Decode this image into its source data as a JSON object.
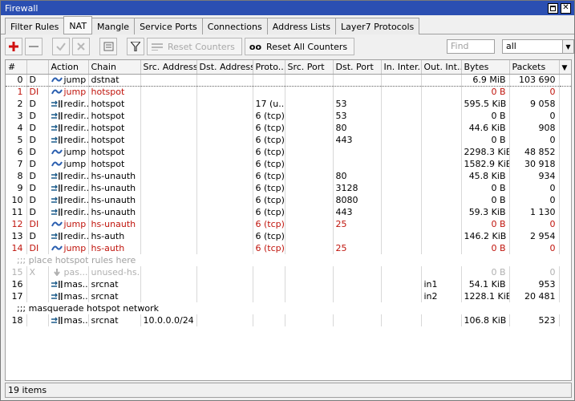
{
  "window": {
    "title": "Firewall"
  },
  "tabs": [
    {
      "label": "Filter Rules",
      "active": false
    },
    {
      "label": "NAT",
      "active": true
    },
    {
      "label": "Mangle",
      "active": false
    },
    {
      "label": "Service Ports",
      "active": false
    },
    {
      "label": "Connections",
      "active": false
    },
    {
      "label": "Address Lists",
      "active": false
    },
    {
      "label": "Layer7 Protocols",
      "active": false
    }
  ],
  "toolbar": {
    "reset_counters_label": "Reset Counters",
    "reset_all_counters_label": "Reset All Counters",
    "oo_label": "oo",
    "find_placeholder": "Find",
    "filter_value": "all"
  },
  "columns": [
    "#",
    "",
    "Action",
    "Chain",
    "Src. Address",
    "Dst. Address",
    "Proto...",
    "Src. Port",
    "Dst. Port",
    "In. Inter...",
    "Out. Int...",
    "Bytes",
    "Packets"
  ],
  "rows": [
    {
      "type": "rule",
      "num": "0",
      "flags": "D",
      "action": "jump",
      "icon": "jump",
      "chain": "dstnat",
      "src": "",
      "dst": "",
      "proto": "",
      "sport": "",
      "dport": "",
      "inif": "",
      "outif": "",
      "bytes": "6.9 MiB",
      "packets": "103 690",
      "state": "selected"
    },
    {
      "type": "rule",
      "num": "1",
      "flags": "DI",
      "action": "jump",
      "icon": "jump",
      "chain": "hotspot",
      "src": "",
      "dst": "",
      "proto": "",
      "sport": "",
      "dport": "",
      "inif": "",
      "outif": "",
      "bytes": "0 B",
      "packets": "0",
      "state": "disabled"
    },
    {
      "type": "rule",
      "num": "2",
      "flags": "D",
      "action": "redir...",
      "icon": "redir",
      "chain": "hotspot",
      "src": "",
      "dst": "",
      "proto": "17 (u...",
      "sport": "",
      "dport": "53",
      "inif": "",
      "outif": "",
      "bytes": "595.5 KiB",
      "packets": "9 058",
      "state": ""
    },
    {
      "type": "rule",
      "num": "3",
      "flags": "D",
      "action": "redir...",
      "icon": "redir",
      "chain": "hotspot",
      "src": "",
      "dst": "",
      "proto": "6 (tcp)",
      "sport": "",
      "dport": "53",
      "inif": "",
      "outif": "",
      "bytes": "0 B",
      "packets": "0",
      "state": ""
    },
    {
      "type": "rule",
      "num": "4",
      "flags": "D",
      "action": "redir...",
      "icon": "redir",
      "chain": "hotspot",
      "src": "",
      "dst": "",
      "proto": "6 (tcp)",
      "sport": "",
      "dport": "80",
      "inif": "",
      "outif": "",
      "bytes": "44.6 KiB",
      "packets": "908",
      "state": ""
    },
    {
      "type": "rule",
      "num": "5",
      "flags": "D",
      "action": "redir...",
      "icon": "redir",
      "chain": "hotspot",
      "src": "",
      "dst": "",
      "proto": "6 (tcp)",
      "sport": "",
      "dport": "443",
      "inif": "",
      "outif": "",
      "bytes": "0 B",
      "packets": "0",
      "state": ""
    },
    {
      "type": "rule",
      "num": "6",
      "flags": "D",
      "action": "jump",
      "icon": "jump",
      "chain": "hotspot",
      "src": "",
      "dst": "",
      "proto": "6 (tcp)",
      "sport": "",
      "dport": "",
      "inif": "",
      "outif": "",
      "bytes": "2298.3 KiB",
      "packets": "48 852",
      "state": ""
    },
    {
      "type": "rule",
      "num": "7",
      "flags": "D",
      "action": "jump",
      "icon": "jump",
      "chain": "hotspot",
      "src": "",
      "dst": "",
      "proto": "6 (tcp)",
      "sport": "",
      "dport": "",
      "inif": "",
      "outif": "",
      "bytes": "1582.9 KiB",
      "packets": "30 918",
      "state": ""
    },
    {
      "type": "rule",
      "num": "8",
      "flags": "D",
      "action": "redir...",
      "icon": "redir",
      "chain": "hs-unauth",
      "src": "",
      "dst": "",
      "proto": "6 (tcp)",
      "sport": "",
      "dport": "80",
      "inif": "",
      "outif": "",
      "bytes": "45.8 KiB",
      "packets": "934",
      "state": ""
    },
    {
      "type": "rule",
      "num": "9",
      "flags": "D",
      "action": "redir...",
      "icon": "redir",
      "chain": "hs-unauth",
      "src": "",
      "dst": "",
      "proto": "6 (tcp)",
      "sport": "",
      "dport": "3128",
      "inif": "",
      "outif": "",
      "bytes": "0 B",
      "packets": "0",
      "state": ""
    },
    {
      "type": "rule",
      "num": "10",
      "flags": "D",
      "action": "redir...",
      "icon": "redir",
      "chain": "hs-unauth",
      "src": "",
      "dst": "",
      "proto": "6 (tcp)",
      "sport": "",
      "dport": "8080",
      "inif": "",
      "outif": "",
      "bytes": "0 B",
      "packets": "0",
      "state": ""
    },
    {
      "type": "rule",
      "num": "11",
      "flags": "D",
      "action": "redir...",
      "icon": "redir",
      "chain": "hs-unauth",
      "src": "",
      "dst": "",
      "proto": "6 (tcp)",
      "sport": "",
      "dport": "443",
      "inif": "",
      "outif": "",
      "bytes": "59.3 KiB",
      "packets": "1 130",
      "state": ""
    },
    {
      "type": "rule",
      "num": "12",
      "flags": "DI",
      "action": "jump",
      "icon": "jump",
      "chain": "hs-unauth",
      "src": "",
      "dst": "",
      "proto": "6 (tcp)",
      "sport": "",
      "dport": "25",
      "inif": "",
      "outif": "",
      "bytes": "0 B",
      "packets": "0",
      "state": "disabled"
    },
    {
      "type": "rule",
      "num": "13",
      "flags": "D",
      "action": "redir...",
      "icon": "redir",
      "chain": "hs-auth",
      "src": "",
      "dst": "",
      "proto": "6 (tcp)",
      "sport": "",
      "dport": "",
      "inif": "",
      "outif": "",
      "bytes": "146.2 KiB",
      "packets": "2 954",
      "state": ""
    },
    {
      "type": "rule",
      "num": "14",
      "flags": "DI",
      "action": "jump",
      "icon": "jump",
      "chain": "hs-auth",
      "src": "",
      "dst": "",
      "proto": "6 (tcp)",
      "sport": "",
      "dport": "25",
      "inif": "",
      "outif": "",
      "bytes": "0 B",
      "packets": "0",
      "state": "disabled"
    },
    {
      "type": "comment",
      "text": ";;; place hotspot rules here",
      "state": "gray"
    },
    {
      "type": "rule",
      "num": "15",
      "flags": "X",
      "action": "pas...",
      "icon": "pass",
      "chain": "unused-hs...",
      "src": "",
      "dst": "",
      "proto": "",
      "sport": "",
      "dport": "",
      "inif": "",
      "outif": "",
      "bytes": "0 B",
      "packets": "0",
      "state": "invalid"
    },
    {
      "type": "rule",
      "num": "16",
      "flags": "",
      "action": "mas...",
      "icon": "redir",
      "chain": "srcnat",
      "src": "",
      "dst": "",
      "proto": "",
      "sport": "",
      "dport": "",
      "inif": "",
      "outif": "in1",
      "bytes": "54.1 KiB",
      "packets": "953",
      "state": ""
    },
    {
      "type": "rule",
      "num": "17",
      "flags": "",
      "action": "mas...",
      "icon": "redir",
      "chain": "srcnat",
      "src": "",
      "dst": "",
      "proto": "",
      "sport": "",
      "dport": "",
      "inif": "",
      "outif": "in2",
      "bytes": "1228.1 KiB",
      "packets": "20 481",
      "state": ""
    },
    {
      "type": "comment",
      "text": ";;; masquerade hotspot network",
      "state": ""
    },
    {
      "type": "rule",
      "num": "18",
      "flags": "",
      "action": "mas...",
      "icon": "redir",
      "chain": "srcnat",
      "src": "10.0.0.0/24",
      "dst": "",
      "proto": "",
      "sport": "",
      "dport": "",
      "inif": "",
      "outif": "",
      "bytes": "106.8 KiB",
      "packets": "523",
      "state": ""
    }
  ],
  "status": {
    "items_count": "19 items"
  },
  "colors": {
    "title_bar": "#2b4fb2",
    "disabled_text": "#c0140c",
    "add_icon": "#d01010"
  }
}
